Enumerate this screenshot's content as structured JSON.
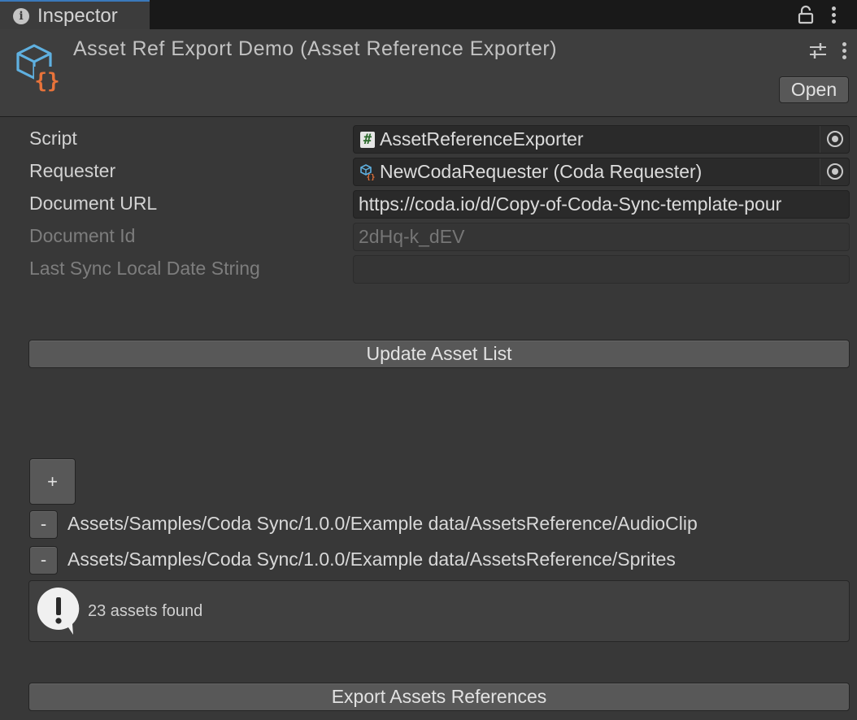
{
  "tab": {
    "label": "Inspector",
    "icon": "info-icon"
  },
  "header": {
    "title": "Asset Ref Export Demo (Asset Reference Exporter)",
    "open_label": "Open",
    "asset_icon": "script-asset-icon"
  },
  "fields": {
    "script": {
      "label": "Script",
      "value": "AssetReferenceExporter"
    },
    "requester": {
      "label": "Requester",
      "value": "NewCodaRequester (Coda Requester)"
    },
    "document_url": {
      "label": "Document URL",
      "value": "https://coda.io/d/Copy-of-Coda-Sync-template-pour"
    },
    "document_id": {
      "label": "Document Id",
      "value": "2dHq-k_dEV"
    },
    "last_sync": {
      "label": "Last Sync Local Date String",
      "value": ""
    }
  },
  "buttons": {
    "update_asset_list": "Update Asset List",
    "add": "+",
    "remove": "-",
    "export": "Export Assets References"
  },
  "asset_paths": [
    "Assets/Samples/Coda Sync/1.0.0/Example data/AssetsReference/AudioClip",
    "Assets/Samples/Coda Sync/1.0.0/Example data/AssetsReference/Sprites"
  ],
  "help": {
    "message": "23 assets found",
    "icon": "warning-icon"
  },
  "colors": {
    "background": "#383838",
    "tab_accent": "#3a79bb",
    "icon_blue": "#5fb0e0",
    "icon_orange": "#e8733a"
  }
}
